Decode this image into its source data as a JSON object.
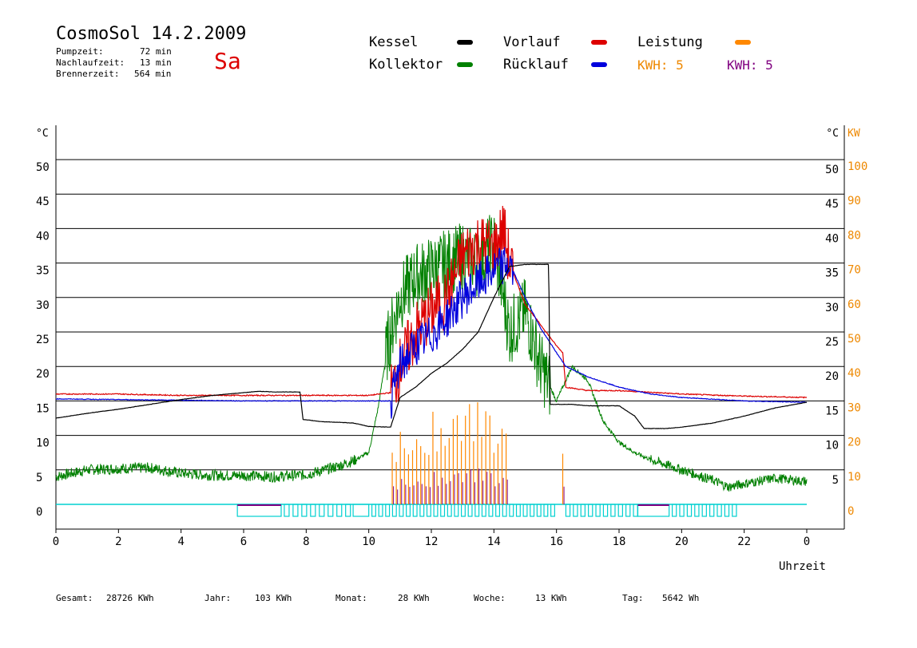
{
  "header": {
    "title": "CosmoSol 14.2.2009",
    "pump_label": "Pumpzeit:",
    "pump_value": "72 min",
    "nachlauf_label": "Nachlaufzeit:",
    "nachlauf_value": "13 min",
    "brenner_label": "Brennerzeit:",
    "brenner_value": "564 min",
    "day": "Sa"
  },
  "legend": {
    "kessel": {
      "label": "Kessel",
      "color": "#000000"
    },
    "kollektor": {
      "label": "Kollektor",
      "color": "#008000"
    },
    "vorlauf": {
      "label": "Vorlauf",
      "color": "#dd0000"
    },
    "ruecklauf": {
      "label": "Rücklauf",
      "color": "#0000dd"
    },
    "leistung": {
      "label": "Leistung",
      "color": "#ff8800"
    },
    "kwh_orange": "KWH: 5",
    "kwh_purple": "KWH: 5",
    "kwh_orange_color": "#ee8800",
    "kwh_purple_color": "#800080"
  },
  "footer": {
    "gesamt_label": "Gesamt:",
    "gesamt_value": "28726 KWh",
    "jahr_label": "Jahr:",
    "jahr_value": "103 KWh",
    "monat_label": "Monat:",
    "monat_value": "28 KWh",
    "woche_label": "Woche:",
    "woche_value": "13 KWh",
    "tag_label": "Tag:",
    "tag_value": "5642 Wh"
  },
  "chart_data": {
    "type": "line",
    "xlabel": "Uhrzeit",
    "ylabel_left": "°C",
    "ylabel_right_temp": "°C",
    "ylabel_right_power": "KW",
    "x_ticks": [
      "0",
      "2",
      "4",
      "6",
      "8",
      "10",
      "12",
      "14",
      "16",
      "18",
      "20",
      "22",
      "0"
    ],
    "y_ticks_left": [
      "0",
      "5",
      "10",
      "15",
      "20",
      "25",
      "30",
      "35",
      "40",
      "45",
      "50"
    ],
    "y_ticks_right_temp": [
      "5",
      "10",
      "15",
      "20",
      "25",
      "30",
      "35",
      "40",
      "45",
      "50"
    ],
    "y_ticks_right_power": [
      "0",
      "10",
      "20",
      "30",
      "40",
      "50",
      "60",
      "70",
      "80",
      "90",
      "100"
    ],
    "xlim": [
      0,
      24
    ],
    "ylim": [
      0,
      50
    ],
    "ylim_power": [
      0,
      100
    ],
    "grid": true,
    "colors": {
      "kessel": "#000000",
      "kollektor": "#008000",
      "vorlauf": "#dd0000",
      "ruecklauf": "#0000dd",
      "leistung": "#ff8800",
      "leistung2": "#800080",
      "pump": "#00d0d0"
    },
    "series": [
      {
        "name": "Kessel",
        "x": [
          0,
          1,
          2,
          3,
          4,
          5,
          6,
          6.5,
          7,
          7.8,
          7.9,
          8.5,
          9.5,
          10,
          10.7,
          11,
          11.5,
          12,
          12.5,
          13,
          13.5,
          14,
          14.5,
          15,
          15.5,
          15.75,
          15.8,
          16,
          16.5,
          17,
          17.5,
          18,
          18.5,
          18.8,
          19,
          19.5,
          20,
          21,
          22,
          23,
          24
        ],
        "y": [
          12.5,
          13.2,
          13.8,
          14.5,
          15.2,
          15.8,
          16.2,
          16.4,
          16.3,
          16.3,
          12.3,
          12.0,
          11.8,
          11.3,
          11.2,
          15.5,
          17,
          19,
          20.5,
          22.5,
          25,
          30,
          34.5,
          34.8,
          34.8,
          34.8,
          14.5,
          14.5,
          14.5,
          14.3,
          14.3,
          14.3,
          12.8,
          11.0,
          11.0,
          11.0,
          11.2,
          11.8,
          12.8,
          14,
          14.8
        ]
      },
      {
        "name": "Kollektor",
        "x": [
          0,
          1,
          2,
          3,
          4,
          5,
          6,
          7,
          8,
          9,
          9.5,
          10,
          10.3,
          10.6,
          11,
          11.5,
          12,
          12.5,
          13,
          13.5,
          14,
          14.5,
          15,
          15.5,
          16,
          16.3,
          16.5,
          17,
          17.5,
          18,
          18.5,
          19,
          20,
          21,
          21.5,
          22,
          23,
          24
        ],
        "y": [
          4,
          5,
          5.2,
          5.3,
          4.5,
          4.2,
          4.2,
          4,
          4.3,
          5.5,
          6.3,
          7.5,
          14,
          23,
          30,
          33,
          34,
          35,
          36,
          35,
          38,
          25,
          28,
          20,
          15,
          18,
          20,
          18,
          12,
          9,
          7.5,
          6.5,
          5,
          3.5,
          2.5,
          3,
          3.8,
          3.3
        ]
      },
      {
        "name": "Vorlauf",
        "x": [
          0,
          2,
          4,
          6,
          8,
          10,
          10.7,
          11,
          11.5,
          12,
          12.5,
          13,
          13.5,
          14,
          14.3,
          14.5,
          15,
          15.5,
          16,
          16.2,
          16.3,
          17,
          18,
          20,
          22,
          24
        ],
        "y": [
          16,
          16,
          15.8,
          15.8,
          15.8,
          15.8,
          16.2,
          20,
          25,
          28,
          30,
          36,
          38,
          37,
          40,
          35,
          29,
          26,
          23,
          22,
          17,
          16.5,
          16.5,
          16,
          15.7,
          15.5
        ]
      },
      {
        "name": "Rücklauf",
        "x": [
          0,
          2,
          4,
          6,
          8,
          10,
          10.7,
          11,
          11.5,
          12,
          12.5,
          13,
          13.5,
          14,
          14.5,
          15,
          15.5,
          16,
          16.3,
          17,
          18,
          19,
          20,
          22,
          24
        ],
        "y": [
          15.3,
          15.2,
          15.1,
          15,
          15,
          15,
          15,
          20,
          23,
          24.5,
          27,
          30,
          32,
          34,
          35,
          30,
          25.5,
          22,
          20,
          18.5,
          17,
          16,
          15.5,
          15,
          14.8
        ]
      },
      {
        "name": "Leistung",
        "x": [
          10.8,
          11,
          11.2,
          11.5,
          11.8,
          12,
          12.3,
          12.5,
          12.7,
          13,
          13.2,
          13.5,
          13.7,
          14,
          14.2,
          14.5,
          16.2
        ],
        "y": [
          15,
          20,
          18,
          22,
          20,
          25,
          22,
          26,
          24,
          27,
          25,
          27,
          26,
          24,
          22,
          18,
          20
        ]
      }
    ]
  }
}
